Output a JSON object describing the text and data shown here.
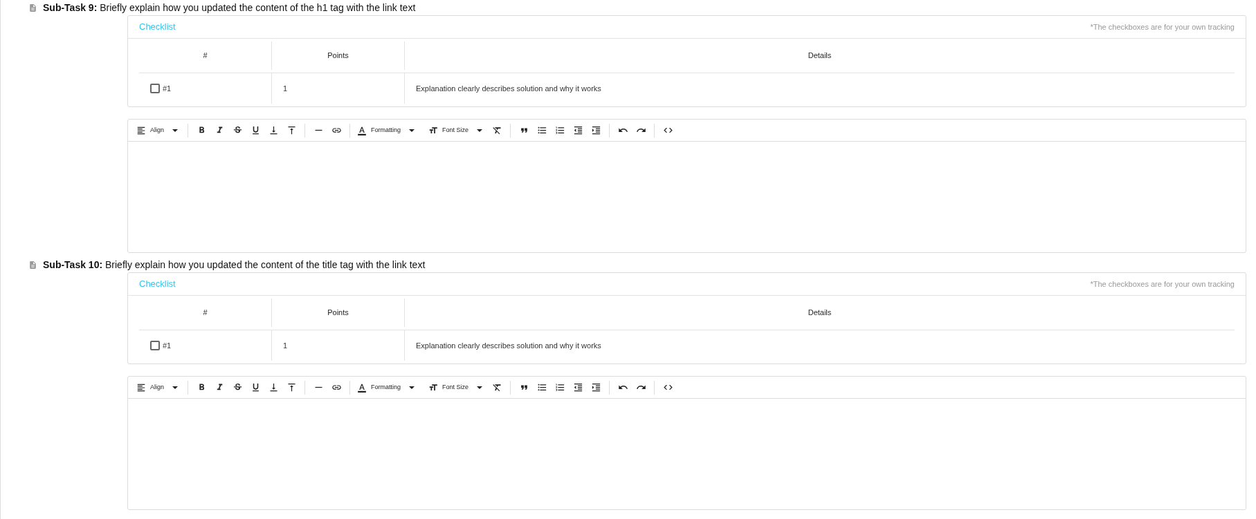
{
  "subtasks": [
    {
      "label": "Sub-Task 9:",
      "prompt": "Briefly explain how you updated the content of the h1 tag with the link text",
      "checklist": {
        "title": "Checklist",
        "note": "*The checkboxes are for your own tracking",
        "columns": [
          "#",
          "Points",
          "Details"
        ],
        "rows": [
          {
            "number": "#1",
            "checked": false,
            "points": "1",
            "details": "Explanation clearly describes solution and why it works"
          }
        ]
      },
      "editor": {
        "align_label": "Align",
        "formatting_label": "Formatting",
        "font_size_label": "Font Size"
      }
    },
    {
      "label": "Sub-Task 10:",
      "prompt": "Briefly explain how you updated the content of the title tag with the link text",
      "checklist": {
        "title": "Checklist",
        "note": "*The checkboxes are for your own tracking",
        "columns": [
          "#",
          "Points",
          "Details"
        ],
        "rows": [
          {
            "number": "#1",
            "checked": false,
            "points": "1",
            "details": "Explanation clearly describes solution and why it works"
          }
        ]
      },
      "editor": {
        "align_label": "Align",
        "formatting_label": "Formatting",
        "font_size_label": "Font Size"
      }
    }
  ]
}
